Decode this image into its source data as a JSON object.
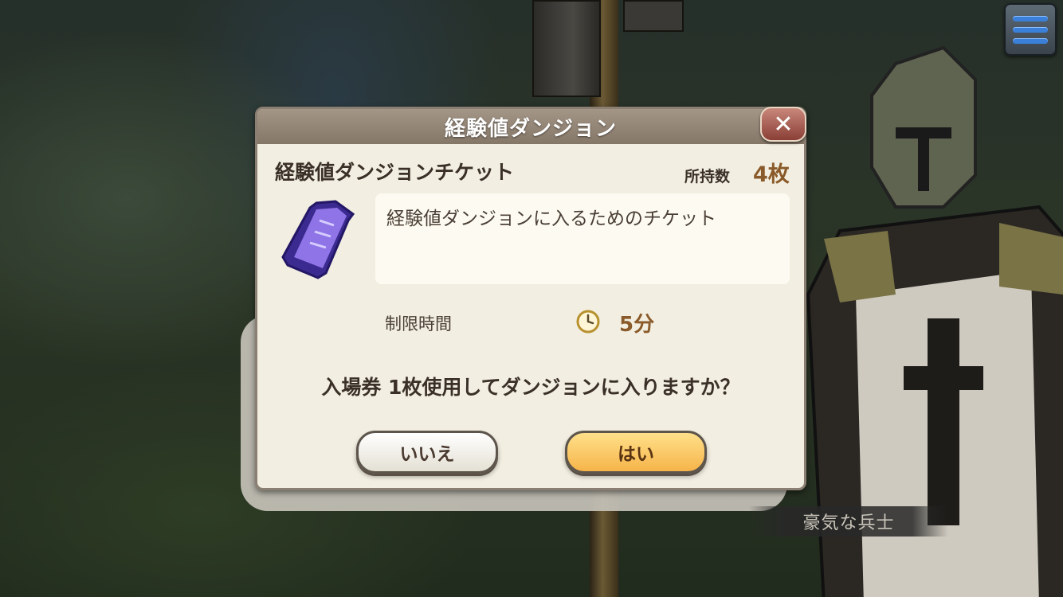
{
  "dialog": {
    "title": "経験値ダンジョン",
    "item_name": "経験値ダンジョンチケット",
    "owned_label": "所持数",
    "owned_count": "4枚",
    "description": "経験値ダンジョンに入るためのチケット",
    "time_limit_label": "制限時間",
    "time_limit_value": "5分",
    "question": "入場券 1枚使用してダンジョンに入りますか？",
    "no_label": "いいえ",
    "yes_label": "はい",
    "close_icon": "close-icon"
  },
  "speaker_name": "豪気な兵士",
  "icons": {
    "menu": "hamburger-menu-icon",
    "ticket": "ticket-icon",
    "clock": "clock-icon"
  },
  "colors": {
    "title_bar": "#857768",
    "yes_button": "#f6b44a",
    "no_button": "#ffffff",
    "accent_text": "#8a5a2a",
    "close_button": "#8a3f36"
  }
}
